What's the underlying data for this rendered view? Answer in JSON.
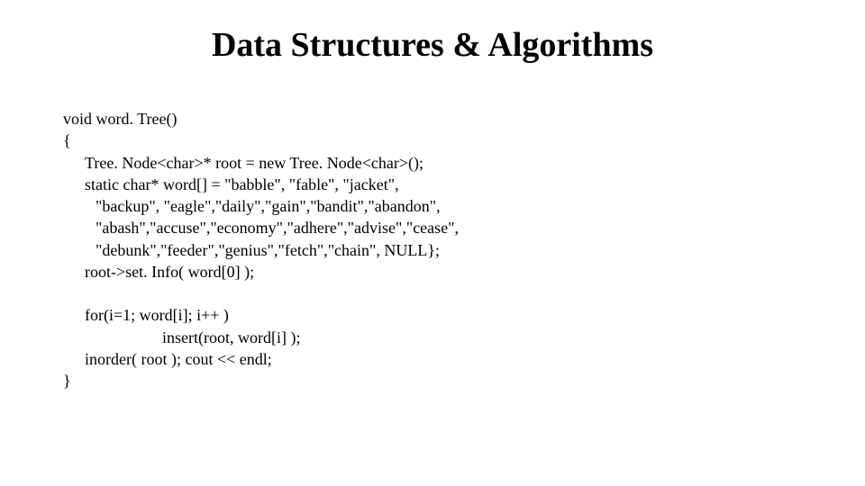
{
  "slide": {
    "title": "Data Structures & Algorithms",
    "code": {
      "line1": "void word. Tree()",
      "line2": "{",
      "line3": "Tree. Node<char>* root = new Tree. Node<char>();",
      "line4": "static char* word[] = \"babble\", \"fable\", \"jacket\",",
      "line5": "\"backup\", \"eagle\",\"daily\",\"gain\",\"bandit\",\"abandon\",",
      "line6": "\"abash\",\"accuse\",\"economy\",\"adhere\",\"advise\",\"cease\",",
      "line7": "\"debunk\",\"feeder\",\"genius\",\"fetch\",\"chain\", NULL};",
      "line8": "root->set. Info( word[0] );",
      "line9": "for(i=1; word[i]; i++ )",
      "line10": "insert(root, word[i] );",
      "line11": "inorder( root ); cout << endl;",
      "line12": "}"
    }
  }
}
